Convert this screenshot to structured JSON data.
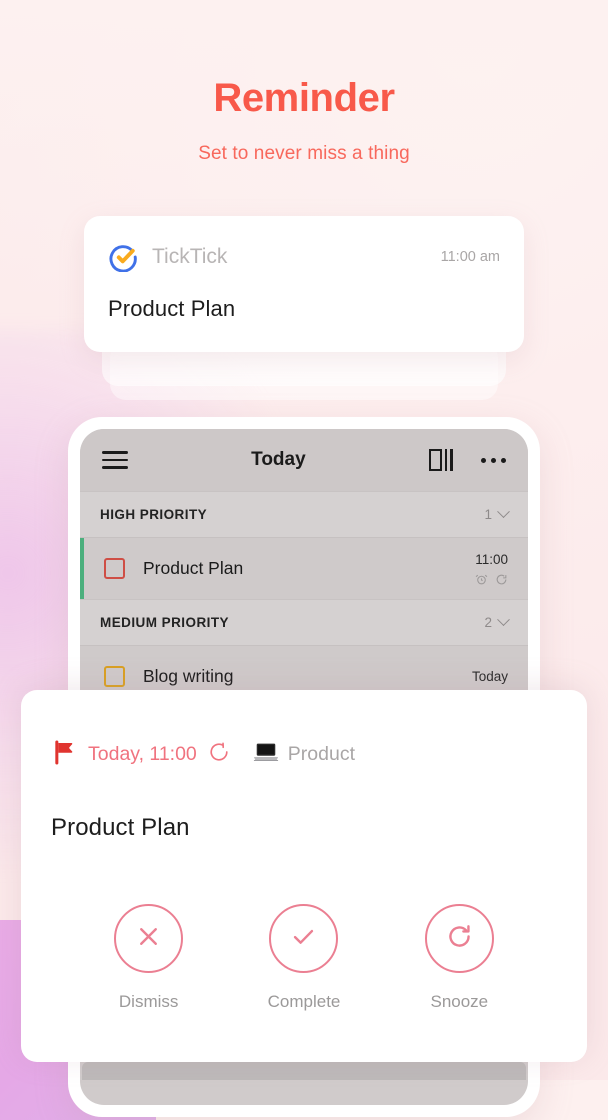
{
  "header": {
    "title": "Reminder",
    "subtitle": "Set to never miss a thing",
    "title_color": "#f8594a",
    "subtitle_color": "#f8685c"
  },
  "notification": {
    "app_icon": "ticktick-logo-icon",
    "app_name": "TickTick",
    "time": "11:00 am",
    "body": "Product Plan"
  },
  "phone_app": {
    "app_bar": {
      "menu_icon": "hamburger-menu-icon",
      "title": "Today",
      "view_icon": "column-view-icon",
      "more_icon": "more-options-icon"
    },
    "sections": [
      {
        "label": "HIGH PRIORITY",
        "count": "1",
        "tasks": [
          {
            "title": "Product Plan",
            "checkbox_color": "#cf4e45",
            "accent_color": "#4caf7d",
            "time": "11:00",
            "icons": [
              "alarm-clock-icon",
              "repeat-icon"
            ]
          }
        ]
      },
      {
        "label": "MEDIUM PRIORITY",
        "count": "2",
        "tasks": [
          {
            "title": "Blog writing",
            "checkbox_color": "#d9a021",
            "accent_color": "",
            "time": "Today",
            "icons": []
          }
        ]
      }
    ]
  },
  "reminder_sheet": {
    "flag_icon": "red-flag-icon",
    "date": "Today, 11:00",
    "repeat_icon": "repeat-icon",
    "project_icon": "laptop-icon",
    "project": "Product",
    "title": "Product Plan",
    "accent_color": "#eb7f92",
    "actions": [
      {
        "label": "Dismiss",
        "icon": "close-icon"
      },
      {
        "label": "Complete",
        "icon": "check-icon"
      },
      {
        "label": "Snooze",
        "icon": "refresh-icon"
      }
    ]
  }
}
